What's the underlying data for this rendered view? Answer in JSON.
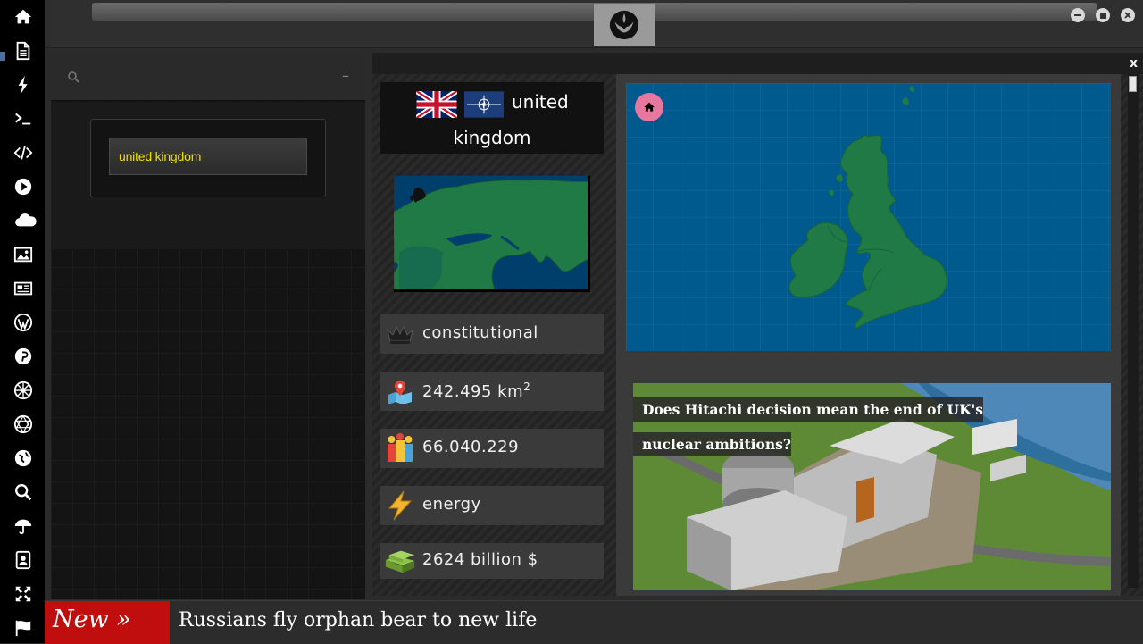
{
  "sidebar": {
    "icons": [
      "home-icon",
      "document-icon",
      "lightning-icon",
      "terminal-icon",
      "code-icon",
      "play-icon",
      "cloud-icon",
      "image-icon",
      "newspaper-icon",
      "wordpress-icon",
      "pinterest-icon",
      "settings-wheel-icon",
      "sphere-icon",
      "globe-icon",
      "search-icon",
      "umbrella-icon",
      "contacts-icon",
      "fullscreen-icon",
      "flag-icon"
    ]
  },
  "window": {
    "emblem": "rebel-alliance-icon",
    "controls": [
      "minimize-icon",
      "maximize-icon",
      "close-icon"
    ]
  },
  "search_panel": {
    "collapse_label": "–",
    "query_value": "united kingdom"
  },
  "country": {
    "name_line1": "united",
    "name_line2": "kingdom",
    "flags": [
      "uk-flag",
      "nato-flag"
    ],
    "government": "constitutional",
    "area": "242.495 km",
    "area_unit_sup": "2",
    "population": "66.040.229",
    "sector": "energy",
    "gdp": "2624 billion $"
  },
  "news": {
    "headline": "Does Hitachi decision mean the end of UK's nuclear ambitions?"
  },
  "ticker": {
    "label": "New »",
    "headline": "Russians fly orphan bear to new life"
  },
  "colors": {
    "ocean": "#005a8e",
    "land": "#1f7a45",
    "ticker_red": "#c00d0d",
    "query_yellow": "#f2e000",
    "home_badge": "#e7779e"
  }
}
